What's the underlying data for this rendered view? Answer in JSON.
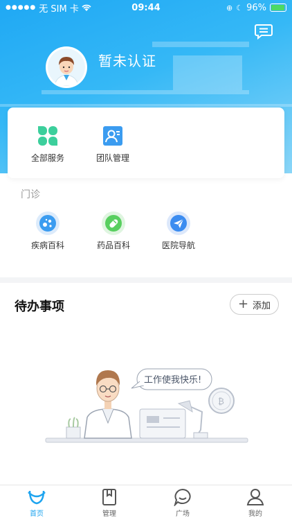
{
  "status_bar": {
    "carrier": "无 SIM 卡",
    "time": "09:44",
    "battery": "96%",
    "battery_level": 0.96
  },
  "header": {
    "user_status": "暂未认证",
    "message_icon": "message-icon"
  },
  "services": [
    {
      "label": "全部服务",
      "icon": "clover-icon",
      "color": "#3ccf9c"
    },
    {
      "label": "团队管理",
      "icon": "team-icon",
      "color": "#3b9cf0"
    }
  ],
  "clinic": {
    "title": "门诊",
    "items": [
      {
        "label": "疾病百科",
        "icon": "virus-icon",
        "color": "#3b9cf0"
      },
      {
        "label": "药品百科",
        "icon": "pill-icon",
        "color": "#58cf5f"
      },
      {
        "label": "医院导航",
        "icon": "paper-plane-icon",
        "color": "#3b8cf0"
      }
    ]
  },
  "todo": {
    "title": "待办事项",
    "add_label": "添加",
    "empty_bubble": "工作使我快乐!"
  },
  "tab_bar": {
    "tabs": [
      {
        "label": "首页",
        "icon": "home-icon",
        "active": true
      },
      {
        "label": "管理",
        "icon": "book-icon",
        "active": false
      },
      {
        "label": "广场",
        "icon": "chat-bubble-icon",
        "active": false
      },
      {
        "label": "我的",
        "icon": "profile-icon",
        "active": false
      }
    ]
  },
  "colors": {
    "accent": "#1ea4ef",
    "header_start": "#1fa8f4",
    "header_end": "#8ad6f8"
  }
}
